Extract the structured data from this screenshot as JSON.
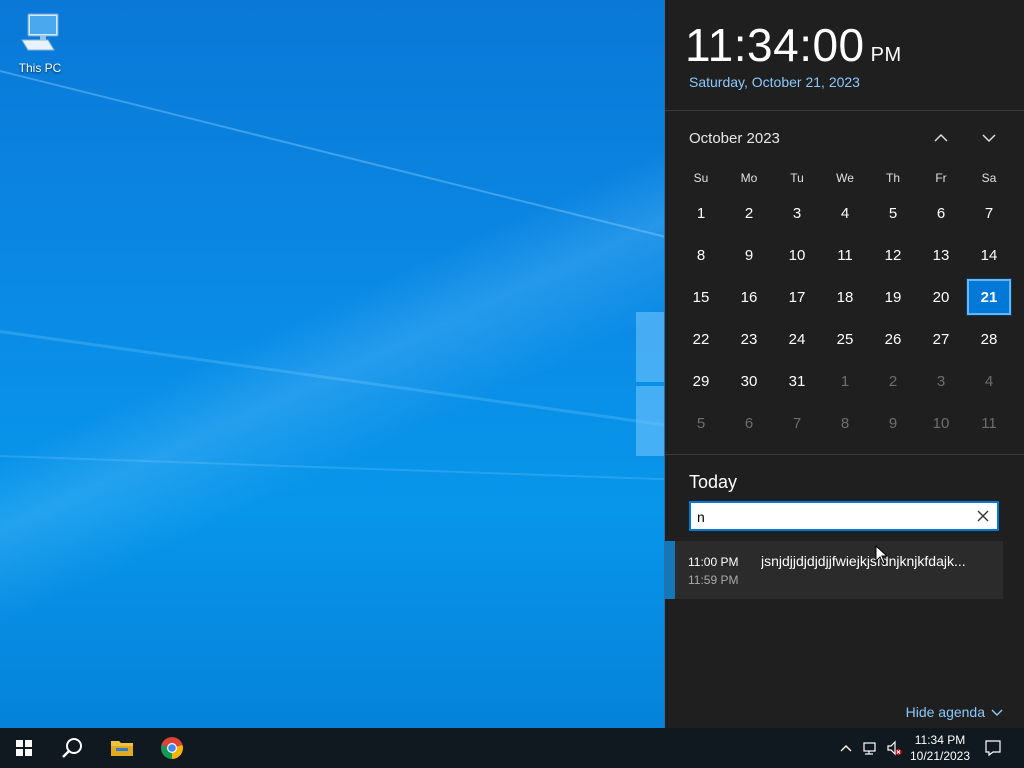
{
  "desktop": {
    "icons": [
      {
        "label": "This PC"
      }
    ]
  },
  "calendar_panel": {
    "time": "11:34:00",
    "ampm": "PM",
    "date": "Saturday, October 21, 2023",
    "month_label": "October 2023",
    "weekdays": [
      "Su",
      "Mo",
      "Tu",
      "We",
      "Th",
      "Fr",
      "Sa"
    ],
    "weeks": [
      [
        "1",
        "2",
        "3",
        "4",
        "5",
        "6",
        "7"
      ],
      [
        "8",
        "9",
        "10",
        "11",
        "12",
        "13",
        "14"
      ],
      [
        "15",
        "16",
        "17",
        "18",
        "19",
        "20",
        "21"
      ],
      [
        "22",
        "23",
        "24",
        "25",
        "26",
        "27",
        "28"
      ],
      [
        "29",
        "30",
        "31",
        "1",
        "2",
        "3",
        "4"
      ],
      [
        "5",
        "6",
        "7",
        "8",
        "9",
        "10",
        "11"
      ]
    ],
    "selected_day": "21",
    "agenda": {
      "heading": "Today",
      "search_value": "n",
      "events": [
        {
          "start": "11:00 PM",
          "end": "11:59 PM",
          "title": "jsnjdjjdjdjdjjfwiejkjsfdnjknjkfdajk..."
        }
      ],
      "hide_label": "Hide agenda"
    }
  },
  "taskbar": {
    "time": "11:34 PM",
    "date": "10/21/2023",
    "accent": "#0078d7"
  }
}
